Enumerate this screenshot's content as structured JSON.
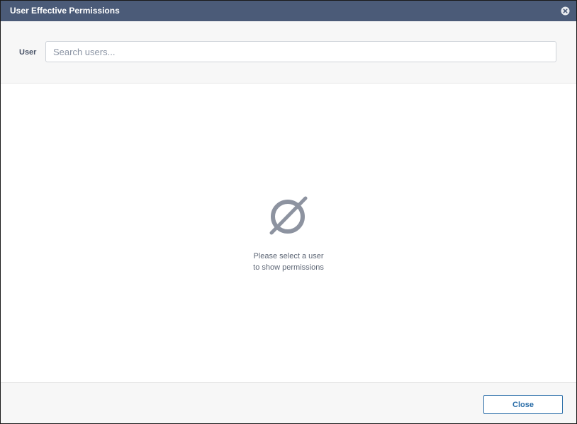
{
  "dialog": {
    "title": "User Effective Permissions",
    "close_icon": "close-circle-icon"
  },
  "filter": {
    "user_label": "User",
    "search_placeholder": "Search users...",
    "search_value": ""
  },
  "empty_state": {
    "icon": "empty-set-icon",
    "line1": "Please select a user",
    "line2": "to show permissions"
  },
  "footer": {
    "close_label": "Close"
  },
  "colors": {
    "titlebar": "#4b5b78",
    "accent": "#2b6ea8",
    "icon_gray": "#8d93a0"
  }
}
